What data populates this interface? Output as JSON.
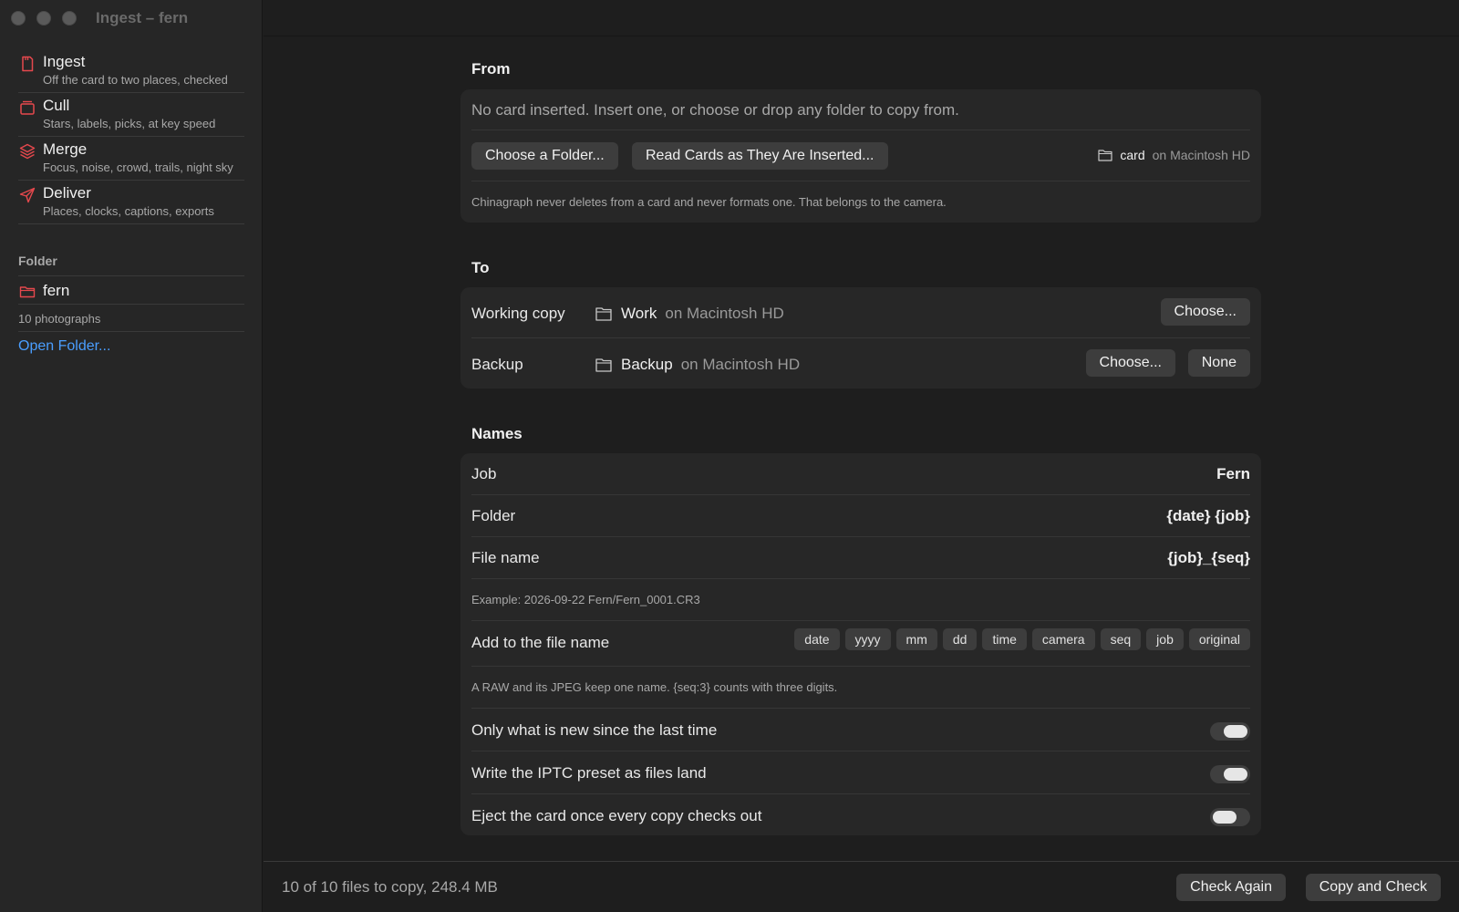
{
  "window": {
    "title": "Ingest – fern"
  },
  "sidebar": {
    "items": [
      {
        "label": "Ingest",
        "subtitle": "Off the card to two places, checked",
        "icon": "sd-card-icon"
      },
      {
        "label": "Cull",
        "subtitle": "Stars, labels, picks, at key speed",
        "icon": "stack-icon"
      },
      {
        "label": "Merge",
        "subtitle": "Focus, noise, crowd, trails, night sky",
        "icon": "layers-icon"
      },
      {
        "label": "Deliver",
        "subtitle": "Places, clocks, captions, exports",
        "icon": "send-icon"
      }
    ],
    "folder_heading": "Folder",
    "folder_name": "fern",
    "photo_count": "10 photographs",
    "open_folder": "Open Folder..."
  },
  "from": {
    "title": "From",
    "message": "No card inserted. Insert one, or choose or drop any folder to copy from.",
    "choose_folder": "Choose a Folder...",
    "read_cards": "Read Cards as They Are Inserted...",
    "source_name": "card",
    "source_location": "on Macintosh HD",
    "note": "Chinagraph never deletes from a card and never formats one. That belongs to the camera."
  },
  "to": {
    "title": "To",
    "working_label": "Working copy",
    "working_name": "Work",
    "working_location": "on Macintosh HD",
    "working_choose": "Choose...",
    "backup_label": "Backup",
    "backup_name": "Backup",
    "backup_location": "on Macintosh HD",
    "backup_choose": "Choose...",
    "backup_none": "None"
  },
  "names": {
    "title": "Names",
    "job_label": "Job",
    "job_value": "Fern",
    "folder_label": "Folder",
    "folder_value": "{date} {job}",
    "filename_label": "File name",
    "filename_value": "{job}_{seq}",
    "example": "Example: 2026-09-22 Fern/Fern_0001.CR3",
    "add_label": "Add to the file name",
    "tokens": [
      "date",
      "yyyy",
      "mm",
      "dd",
      "time",
      "camera",
      "seq",
      "job",
      "original"
    ],
    "raw_note": "A RAW and its JPEG keep one name. {seq:3} counts with three digits.",
    "toggles": [
      {
        "label": "Only what is new since the last time",
        "on": true
      },
      {
        "label": "Write the IPTC preset as files land",
        "on": true
      },
      {
        "label": "Eject the card once every copy checks out",
        "on": false
      }
    ]
  },
  "footer": {
    "status": "10 of 10 files to copy, 248.4 MB",
    "check_again": "Check Again",
    "copy_and_check": "Copy and Check"
  },
  "colors": {
    "accent_red": "#e5484d",
    "link_blue": "#4a9eff"
  }
}
